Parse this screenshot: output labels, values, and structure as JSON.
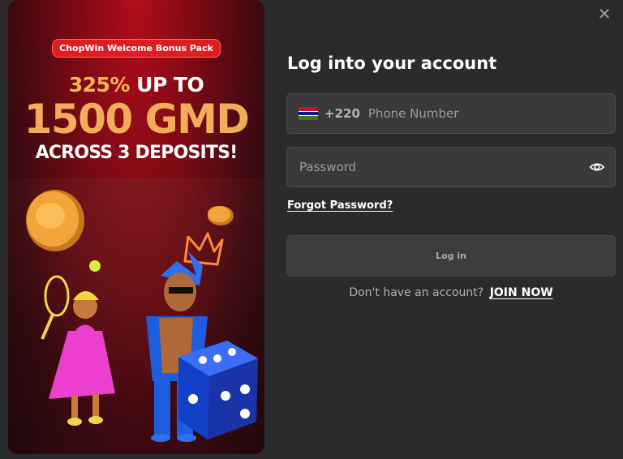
{
  "modal": {
    "close_icon": "close-icon"
  },
  "promo": {
    "badge": "ChopWin Welcome Bonus Pack",
    "percent": "325%",
    "up_to": "UP TO",
    "amount": "1500 GMD",
    "subline": "ACROSS 3 DEPOSITS!",
    "colors": {
      "accent": "#f3ad5a",
      "badge": "#e11b22",
      "bg": "#7a0a14"
    }
  },
  "login": {
    "title": "Log into your account",
    "country_code": "+220",
    "phone_placeholder": "Phone Number",
    "password_placeholder": "Password",
    "forgot_password": "Forgot Password?",
    "login_button": "Log in",
    "no_account_text": "Don't have an account?",
    "join_now": "JOIN NOW"
  },
  "icons": {
    "flag": "gambia-flag-icon",
    "eye": "eye-icon"
  }
}
